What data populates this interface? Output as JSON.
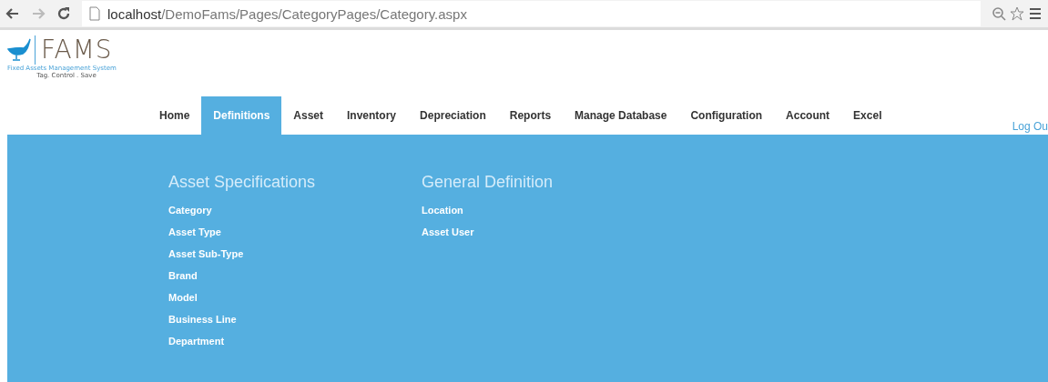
{
  "browser": {
    "url_host": "localhost",
    "url_path": "/DemoFams/Pages/CategoryPages/Category.aspx"
  },
  "logo": {
    "name": "FAMS",
    "subtitle": "Fixed Assets Management System",
    "tagline": "Tag. Control . Save"
  },
  "nav": [
    {
      "label": "Home",
      "selected": false
    },
    {
      "label": "Definitions",
      "selected": true
    },
    {
      "label": "Asset",
      "selected": false
    },
    {
      "label": "Inventory",
      "selected": false
    },
    {
      "label": "Depreciation",
      "selected": false
    },
    {
      "label": "Reports",
      "selected": false
    },
    {
      "label": "Manage Database",
      "selected": false
    },
    {
      "label": "Configuration",
      "selected": false
    },
    {
      "label": "Account",
      "selected": false
    },
    {
      "label": "Excel",
      "selected": false
    }
  ],
  "logout": "Log Ou",
  "sections": [
    {
      "title": "Asset Specifications",
      "links": [
        "Category",
        "Asset Type",
        "Asset Sub-Type",
        "Brand",
        "Model",
        "Business Line",
        "Department"
      ]
    },
    {
      "title": "General Definition",
      "links": [
        "Location",
        "Asset User"
      ]
    }
  ]
}
